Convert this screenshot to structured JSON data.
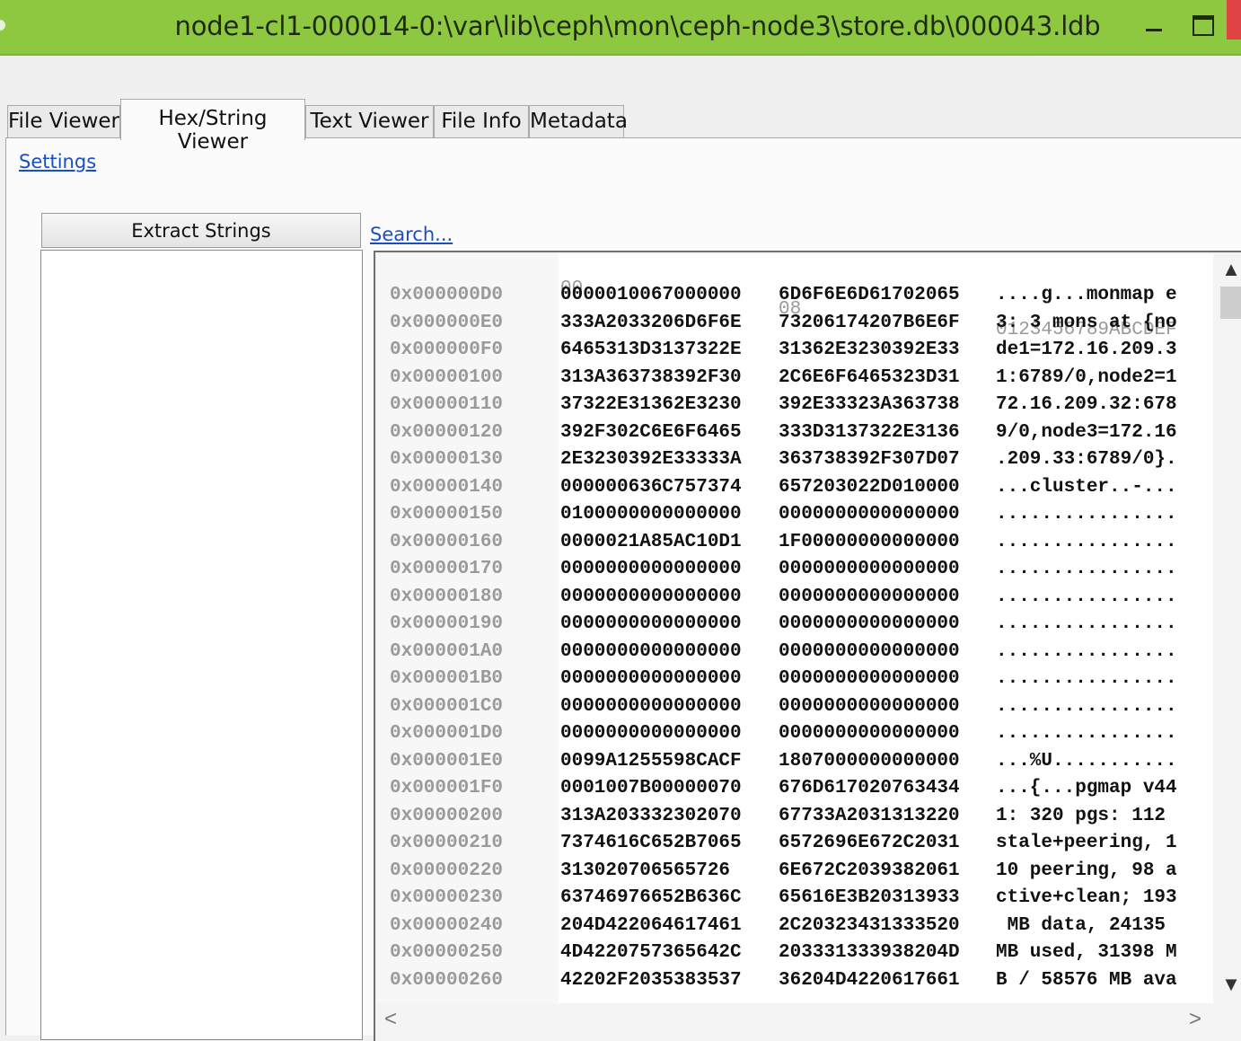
{
  "window": {
    "title": "node1-cl1-000014-0:\\var\\lib\\ceph\\mon\\ceph-node3\\store.db\\000043.ldb",
    "accent_color": "#8dc840"
  },
  "tabs": [
    {
      "label": "File Viewer"
    },
    {
      "label": "Hex/String Viewer",
      "active": true
    },
    {
      "label": "Text Viewer"
    },
    {
      "label": "File Info"
    },
    {
      "label": "Metadata"
    }
  ],
  "settings_link": "Settings",
  "extract_strings_label": "Extract Strings",
  "search_link": "Search...",
  "hex_header": {
    "col0": "00",
    "col1": "08",
    "ascii": "0123456789ABCDEF"
  },
  "hex_rows": [
    {
      "offset": "0x000000D0",
      "h0": "0000010067000000",
      "h1": "6D6F6E6D61702065",
      "ascii": "....g...monmap e"
    },
    {
      "offset": "0x000000E0",
      "h0": "333A2033206D6F6E",
      "h1": "73206174207B6E6F",
      "ascii": "3: 3 mons at {no"
    },
    {
      "offset": "0x000000F0",
      "h0": "6465313D3137322E",
      "h1": "31362E3230392E33",
      "ascii": "de1=172.16.209.3"
    },
    {
      "offset": "0x00000100",
      "h0": "313A363738392F30",
      "h1": "2C6E6F6465323D31",
      "ascii": "1:6789/0,node2=1"
    },
    {
      "offset": "0x00000110",
      "h0": "37322E31362E3230",
      "h1": "392E33323A363738",
      "ascii": "72.16.209.32:678"
    },
    {
      "offset": "0x00000120",
      "h0": "392F302C6E6F6465",
      "h1": "333D3137322E3136",
      "ascii": "9/0,node3=172.16"
    },
    {
      "offset": "0x00000130",
      "h0": "2E3230392E33333A",
      "h1": "363738392F307D07",
      "ascii": ".209.33:6789/0}."
    },
    {
      "offset": "0x00000140",
      "h0": "000000636C757374",
      "h1": "657203022D010000",
      "ascii": "...cluster..-..."
    },
    {
      "offset": "0x00000150",
      "h0": "0100000000000000",
      "h1": "0000000000000000",
      "ascii": "................"
    },
    {
      "offset": "0x00000160",
      "h0": "0000021A85AC10D1",
      "h1": "1F00000000000000",
      "ascii": "................"
    },
    {
      "offset": "0x00000170",
      "h0": "0000000000000000",
      "h1": "0000000000000000",
      "ascii": "................"
    },
    {
      "offset": "0x00000180",
      "h0": "0000000000000000",
      "h1": "0000000000000000",
      "ascii": "................"
    },
    {
      "offset": "0x00000190",
      "h0": "0000000000000000",
      "h1": "0000000000000000",
      "ascii": "................"
    },
    {
      "offset": "0x000001A0",
      "h0": "0000000000000000",
      "h1": "0000000000000000",
      "ascii": "................"
    },
    {
      "offset": "0x000001B0",
      "h0": "0000000000000000",
      "h1": "0000000000000000",
      "ascii": "................"
    },
    {
      "offset": "0x000001C0",
      "h0": "0000000000000000",
      "h1": "0000000000000000",
      "ascii": "................"
    },
    {
      "offset": "0x000001D0",
      "h0": "0000000000000000",
      "h1": "0000000000000000",
      "ascii": "................"
    },
    {
      "offset": "0x000001E0",
      "h0": "0099A1255598CACF",
      "h1": "1807000000000000",
      "ascii": "...%U..........."
    },
    {
      "offset": "0x000001F0",
      "h0": "0001007B00000070",
      "h1": "676D617020763434",
      "ascii": "...{...pgmap v44"
    },
    {
      "offset": "0x00000200",
      "h0": "313A203332302070",
      "h1": "67733A2031313220",
      "ascii": "1: 320 pgs: 112 "
    },
    {
      "offset": "0x00000210",
      "h0": "7374616C652B7065",
      "h1": "6572696E672C2031",
      "ascii": "stale+peering, 1"
    },
    {
      "offset": "0x00000220",
      "h0": "313020706565726",
      "h1": "6E672C2039382061",
      "ascii": "10 peering, 98 a"
    },
    {
      "offset": "0x00000230",
      "h0": "63746976652B636C",
      "h1": "65616E3B20313933",
      "ascii": "ctive+clean; 193"
    },
    {
      "offset": "0x00000240",
      "h0": "204D422064617461",
      "h1": "2C20323431333520",
      "ascii": " MB data, 24135 "
    },
    {
      "offset": "0x00000250",
      "h0": "4D4220757365642C",
      "h1": "203331333938204D",
      "ascii": "MB used, 31398 M"
    },
    {
      "offset": "0x00000260",
      "h0": "42202F2035383537",
      "h1": "36204D4220617661",
      "ascii": "B / 58576 MB ava"
    }
  ],
  "icons": {
    "scroll_up": "▲",
    "scroll_down": "▼",
    "scroll_left": "<",
    "scroll_right": ">"
  }
}
